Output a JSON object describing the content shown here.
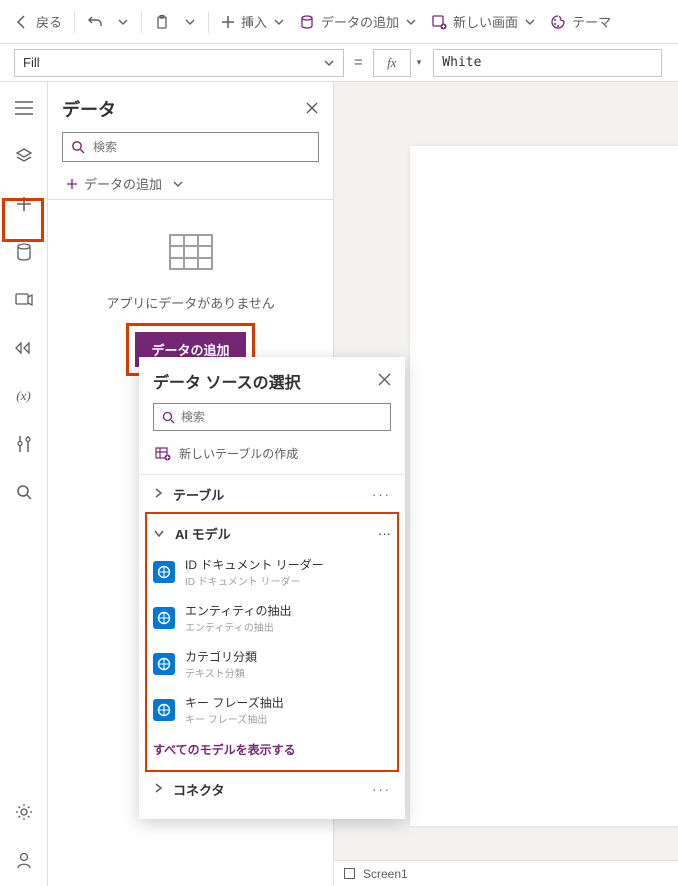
{
  "toolbar": {
    "back_label": "戻る",
    "insert_label": "挿入",
    "add_data_label": "データの追加",
    "new_screen_label": "新しい画面",
    "theme_label": "テーマ"
  },
  "formula": {
    "property": "Fill",
    "fx": "fx",
    "value": "White"
  },
  "data_panel": {
    "title": "データ",
    "search_placeholder": "検索",
    "add_data_label": "データの追加",
    "empty_text": "アプリにデータがありません",
    "add_button": "データの追加"
  },
  "flyout": {
    "title": "データ ソースの選択",
    "search_placeholder": "検索",
    "new_table_label": "新しいテーブルの作成",
    "sections": {
      "tables": "テーブル",
      "ai_models": "AI モデル",
      "connectors": "コネクタ"
    },
    "ai_items": [
      {
        "title": "ID ドキュメント リーダー",
        "sub": "ID ドキュメント リーダー"
      },
      {
        "title": "エンティティの抽出",
        "sub": "エンティティの抽出"
      },
      {
        "title": "カテゴリ分類",
        "sub": "テキスト分類"
      },
      {
        "title": "キー フレーズ抽出",
        "sub": "キー フレーズ抽出"
      }
    ],
    "show_all": "すべてのモデルを表示する"
  },
  "footer": {
    "screen": "Screen1"
  }
}
